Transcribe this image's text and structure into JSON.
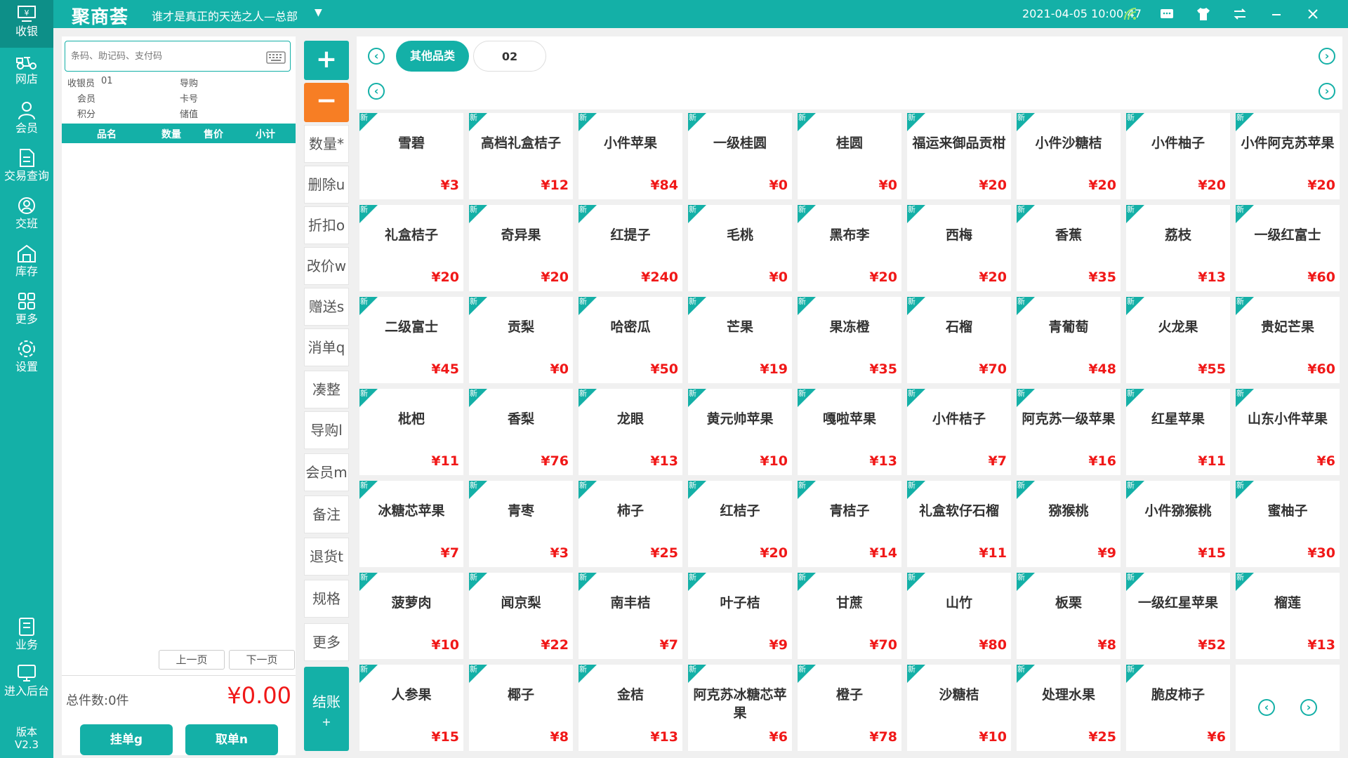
{
  "sidebar": {
    "items": [
      {
        "label": "收银",
        "icon": "cashier-icon"
      },
      {
        "label": "网店",
        "icon": "scooter-icon"
      },
      {
        "label": "会员",
        "icon": "member-icon"
      },
      {
        "label": "交易查询",
        "icon": "document-icon"
      },
      {
        "label": "交班",
        "icon": "handover-icon"
      },
      {
        "label": "库存",
        "icon": "warehouse-icon"
      },
      {
        "label": "更多",
        "icon": "grid-icon"
      },
      {
        "label": "设置",
        "icon": "gear-icon"
      },
      {
        "label": "业务",
        "icon": "book-icon"
      },
      {
        "label": "进入后台",
        "icon": "monitor-icon"
      }
    ],
    "version_label": "版本",
    "version": "V2.3"
  },
  "topbar": {
    "logo": "聚商荟",
    "store": "谁才是真正的天选之人—总部",
    "datetime": "2021-04-05 10:00:47"
  },
  "order": {
    "search_placeholder": "条码、助记码、支付码",
    "cashier_label": "收银员",
    "cashier_value": "01",
    "guide_label": "导购",
    "member_label": "会员",
    "card_label": "卡号",
    "points_label": "积分",
    "balance_label": "储值",
    "columns": [
      "品名",
      "数量",
      "售价",
      "小计"
    ],
    "prev_page": "上一页",
    "next_page": "下一页",
    "total_count": "总件数:0件",
    "total_amount": "¥0.00",
    "hold": "挂单g",
    "retrieve": "取单n"
  },
  "actions": {
    "plus": "+",
    "minus": "−",
    "buttons": [
      "数量*",
      "删除u",
      "折扣o",
      "改价w",
      "赠送s",
      "消单q",
      "凑整",
      "导购l",
      "会员m",
      "备注",
      "退货t",
      "规格",
      "更多"
    ],
    "checkout": "结账",
    "checkout_key": "+"
  },
  "categories": {
    "tabs": [
      "其他品类",
      "02"
    ],
    "active": "其他品类"
  },
  "badge": "新",
  "products": [
    {
      "name": "雪碧",
      "price": "¥3"
    },
    {
      "name": "高档礼盒桔子",
      "price": "¥12"
    },
    {
      "name": "小件苹果",
      "price": "¥84"
    },
    {
      "name": "一级桂圆",
      "price": "¥0"
    },
    {
      "name": "桂圆",
      "price": "¥0"
    },
    {
      "name": "福运来御品贡柑",
      "price": "¥20"
    },
    {
      "name": "小件沙糖桔",
      "price": "¥20"
    },
    {
      "name": "小件柚子",
      "price": "¥20"
    },
    {
      "name": "小件阿克苏苹果",
      "price": "¥20"
    },
    {
      "name": "礼盒桔子",
      "price": "¥20"
    },
    {
      "name": "奇异果",
      "price": "¥20"
    },
    {
      "name": "红提子",
      "price": "¥240"
    },
    {
      "name": "毛桃",
      "price": "¥0"
    },
    {
      "name": "黑布李",
      "price": "¥20"
    },
    {
      "name": "西梅",
      "price": "¥20"
    },
    {
      "name": "香蕉",
      "price": "¥35"
    },
    {
      "name": "荔枝",
      "price": "¥13"
    },
    {
      "name": "一级红富士",
      "price": "¥60"
    },
    {
      "name": "二级富士",
      "price": "¥45"
    },
    {
      "name": "贡梨",
      "price": "¥0"
    },
    {
      "name": "哈密瓜",
      "price": "¥50"
    },
    {
      "name": "芒果",
      "price": "¥19"
    },
    {
      "name": "果冻橙",
      "price": "¥35"
    },
    {
      "name": "石榴",
      "price": "¥70"
    },
    {
      "name": "青葡萄",
      "price": "¥48"
    },
    {
      "name": "火龙果",
      "price": "¥55"
    },
    {
      "name": "贵妃芒果",
      "price": "¥60"
    },
    {
      "name": "枇杷",
      "price": "¥11"
    },
    {
      "name": "香梨",
      "price": "¥76"
    },
    {
      "name": "龙眼",
      "price": "¥13"
    },
    {
      "name": "黄元帅苹果",
      "price": "¥10"
    },
    {
      "name": "嘎啦苹果",
      "price": "¥13"
    },
    {
      "name": "小件桔子",
      "price": "¥7"
    },
    {
      "name": "阿克苏一级苹果",
      "price": "¥16"
    },
    {
      "name": "红星苹果",
      "price": "¥11"
    },
    {
      "name": "山东小件苹果",
      "price": "¥6"
    },
    {
      "name": "冰糖芯苹果",
      "price": "¥7"
    },
    {
      "name": "青枣",
      "price": "¥3"
    },
    {
      "name": "柿子",
      "price": "¥25"
    },
    {
      "name": "红桔子",
      "price": "¥20"
    },
    {
      "name": "青桔子",
      "price": "¥14"
    },
    {
      "name": "礼盒软仔石榴",
      "price": "¥11"
    },
    {
      "name": "猕猴桃",
      "price": "¥9"
    },
    {
      "name": "小件猕猴桃",
      "price": "¥15"
    },
    {
      "name": "蜜柚子",
      "price": "¥30"
    },
    {
      "name": "菠萝肉",
      "price": "¥10"
    },
    {
      "name": "闻京梨",
      "price": "¥22"
    },
    {
      "name": "南丰桔",
      "price": "¥7"
    },
    {
      "name": "叶子桔",
      "price": "¥9"
    },
    {
      "name": "甘蔗",
      "price": "¥70"
    },
    {
      "name": "山竹",
      "price": "¥80"
    },
    {
      "name": "板栗",
      "price": "¥8"
    },
    {
      "name": "一级红星苹果",
      "price": "¥52"
    },
    {
      "name": "榴莲",
      "price": "¥13"
    },
    {
      "name": "人参果",
      "price": "¥15"
    },
    {
      "name": "椰子",
      "price": "¥8"
    },
    {
      "name": "金桔",
      "price": "¥13"
    },
    {
      "name": "阿克苏冰糖芯苹果",
      "price": "¥6"
    },
    {
      "name": "橙子",
      "price": "¥78"
    },
    {
      "name": "沙糖桔",
      "price": "¥10"
    },
    {
      "name": "处理水果",
      "price": "¥25"
    },
    {
      "name": "脆皮柿子",
      "price": "¥6"
    }
  ]
}
